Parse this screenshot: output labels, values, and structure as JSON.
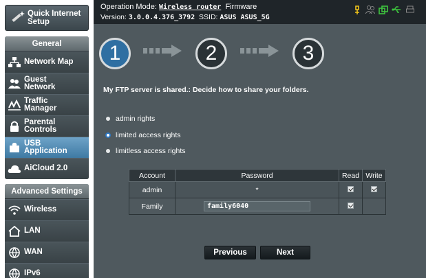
{
  "sidebar": {
    "quick_setup_label": "Quick Internet Setup",
    "general_header": "General",
    "general_items": [
      {
        "label": "Network Map"
      },
      {
        "label": "Guest Network"
      },
      {
        "label": "Traffic Manager"
      },
      {
        "label": "Parental Controls"
      },
      {
        "label": "USB Application"
      },
      {
        "label": "AiCloud 2.0"
      }
    ],
    "advanced_header": "Advanced Settings",
    "advanced_items": [
      {
        "label": "Wireless"
      },
      {
        "label": "LAN"
      },
      {
        "label": "WAN"
      },
      {
        "label": "IPv6"
      }
    ],
    "active_item": "USB Application"
  },
  "topbar": {
    "op_mode_prefix": "Operation Mode:",
    "op_mode_value": "Wireless router",
    "firmware_label": "Firmware",
    "version_label": "Version:",
    "version_value": "3.0.0.4.376_3792",
    "ssid_label": "SSID:",
    "ssid_value": "ASUS ASUS_5G"
  },
  "wizard": {
    "steps": [
      "1",
      "2",
      "3"
    ],
    "current_step": "1",
    "message": "My FTP server is shared.: Decide how to share your folders."
  },
  "rights": {
    "options": [
      "admin rights",
      "limited access rights",
      "limitless access rights"
    ],
    "selected": "limited access rights"
  },
  "table": {
    "headers": [
      "Account",
      "Password",
      "Read",
      "Write"
    ],
    "rows": [
      {
        "account": "admin",
        "password": "*",
        "read": true,
        "write": true
      },
      {
        "account": "Family",
        "password": "family6040",
        "read": true,
        "write": false
      }
    ]
  },
  "buttons": {
    "previous": "Previous",
    "next": "Next"
  },
  "colors": {
    "active_nav": "#3f7aa3",
    "active_step": "#2f6fa2",
    "panel_bg": "#4f595e",
    "status_yellow": "#f0c419",
    "status_green": "#3ec43e"
  }
}
